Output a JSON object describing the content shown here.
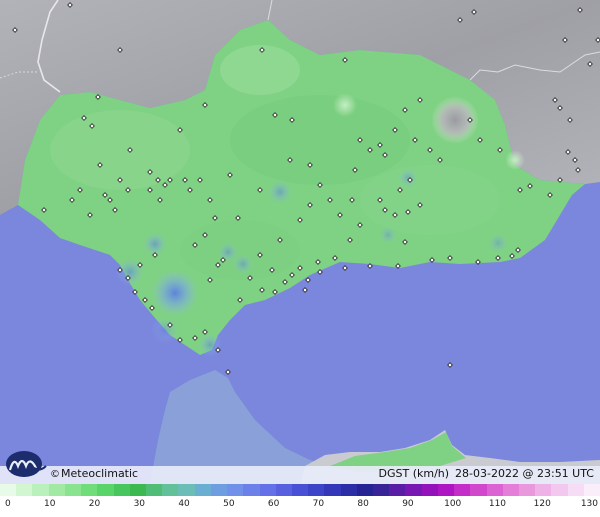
{
  "map": {
    "attribution": "Meteoclimatic",
    "attribution_symbol": "©",
    "variable": "DGST (km/h)",
    "date": "28-03-2022",
    "time_separator": "@",
    "time": "23:51 UTC"
  },
  "legend": {
    "unit": "km/h",
    "labels": [
      "0",
      "10",
      "20",
      "30",
      "40",
      "50",
      "60",
      "70",
      "80",
      "90",
      "100",
      "110",
      "120",
      "130"
    ],
    "colors": [
      "#e8fbe8",
      "#d2f5d2",
      "#baf0bb",
      "#a2eaa4",
      "#8ae38e",
      "#70dc7a",
      "#58d468",
      "#46c65c",
      "#3cb850",
      "#50bd77",
      "#62c198",
      "#6cbcb7",
      "#6aaed2",
      "#6e9ee0",
      "#7090ea",
      "#6c80ea",
      "#6470e8",
      "#5860e0",
      "#4a50d6",
      "#3e44c8",
      "#3438b8",
      "#2c2ea8",
      "#262494",
      "#382496",
      "#5a1ea6",
      "#7818b2",
      "#9412bc",
      "#ae16c4",
      "#c42ec8",
      "#d248cc",
      "#dc64d2",
      "#e47ed8",
      "#ea98de",
      "#eeb2e6",
      "#f2c8ee",
      "#f6dcf4",
      "#faeefa"
    ]
  },
  "colors": {
    "sea": "#7b86dd",
    "land_high_wind_gust": "#7fd183",
    "land_outside_region": "#a7a8ad",
    "morocco_coast": "#8aa0d8"
  }
}
